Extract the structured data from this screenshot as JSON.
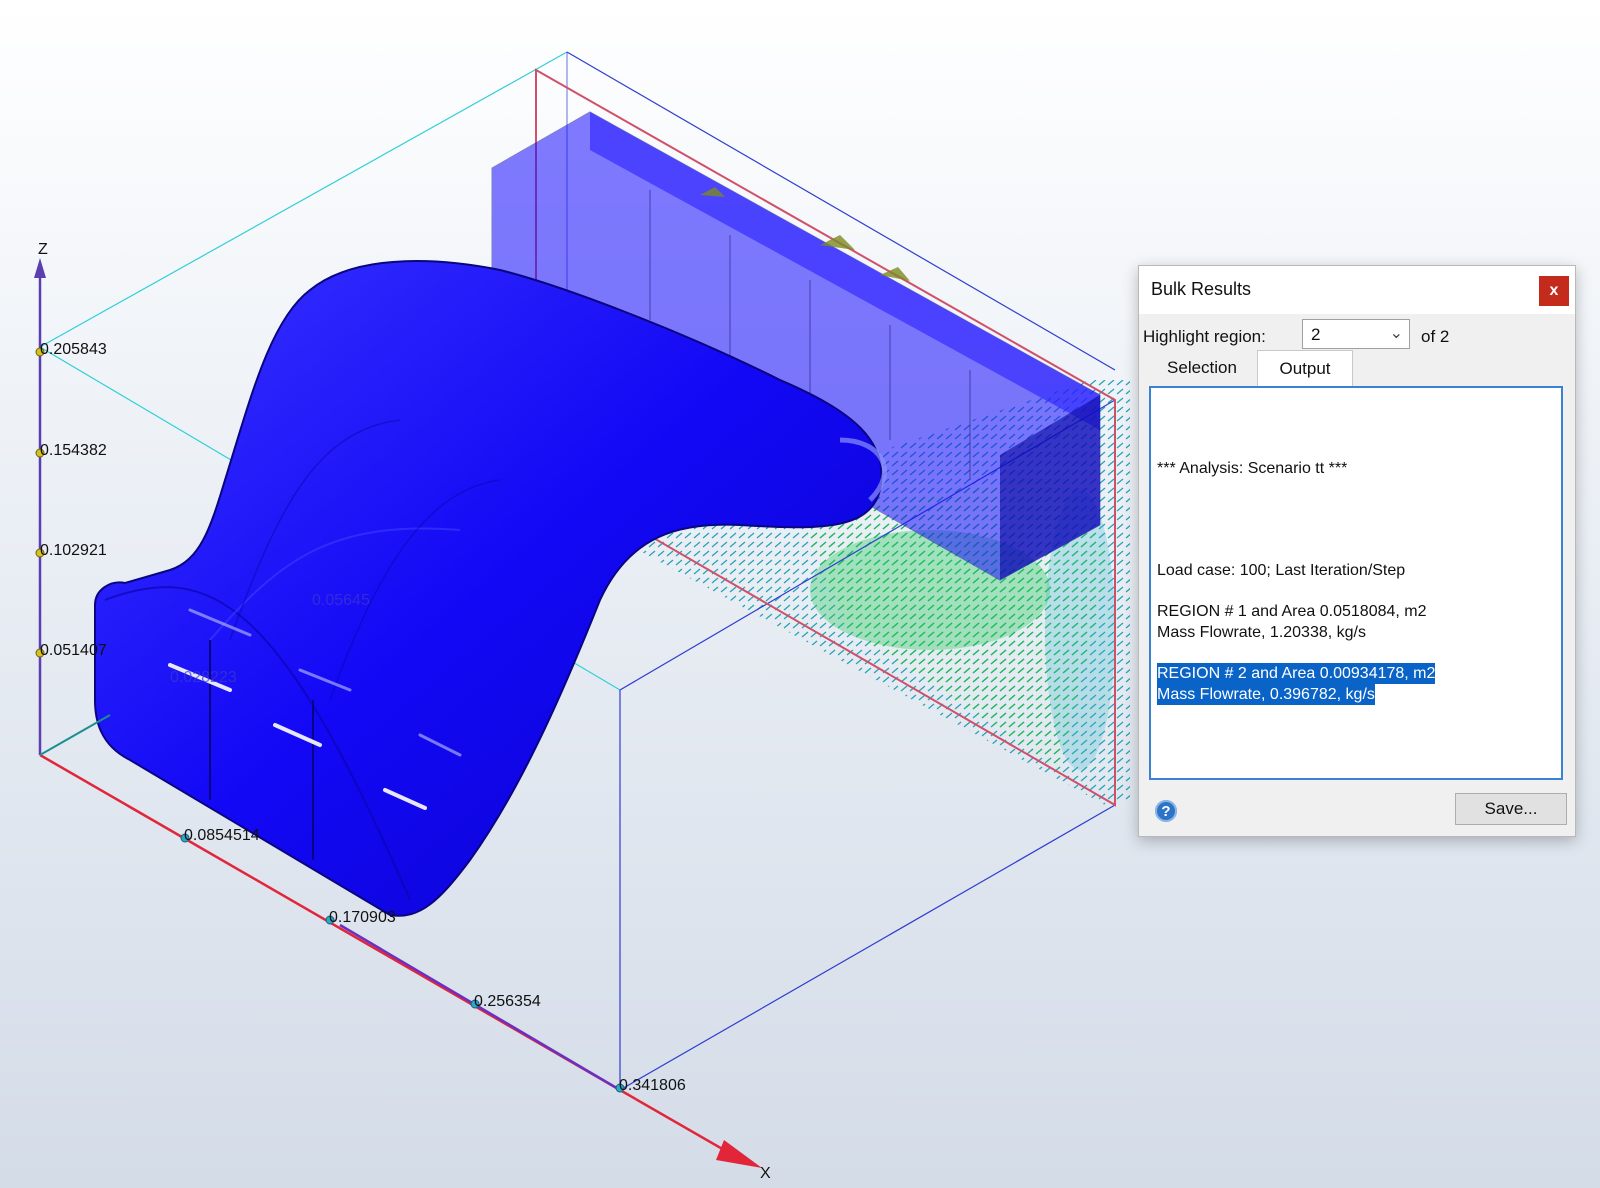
{
  "viewport": {
    "z_axis_label": "Z",
    "x_axis_label": "X",
    "z_ticks": [
      "0.205843",
      "0.154382",
      "0.102921",
      "0.051407"
    ],
    "x_ticks": [
      "0.0854514",
      "0.170903",
      "0.256354",
      "0.341806"
    ],
    "faded_labels": [
      "0.05645",
      "0.028223"
    ],
    "colors": {
      "duct": "#1a10ff",
      "axis_x": "#e2263a",
      "axis_z": "#5b3fb0",
      "bbox": "#2d3ecf",
      "highlight_plane": "#d0506a",
      "flow_low": "#2ab5c8",
      "flow_high": "#1fd060"
    }
  },
  "dialog": {
    "title": "Bulk Results",
    "close_label": "x",
    "highlight_label": "Highlight region:",
    "highlight_value": "2",
    "of_label": "of 2",
    "tabs": {
      "selection": "Selection",
      "output": "Output"
    },
    "output": {
      "analysis": "*** Analysis: Scenario tt ***",
      "load_case": "Load case: 100; Last Iteration/Step",
      "region1_area": "REGION # 1 and Area 0.0518084, m2",
      "region1_flow": "Mass Flowrate, 1.20338, kg/s",
      "region2_area": "REGION # 2 and Area 0.00934178, m2",
      "region2_flow": "Mass Flowrate, 0.396782, kg/s"
    },
    "help_icon": "?",
    "save_label": "Save..."
  }
}
